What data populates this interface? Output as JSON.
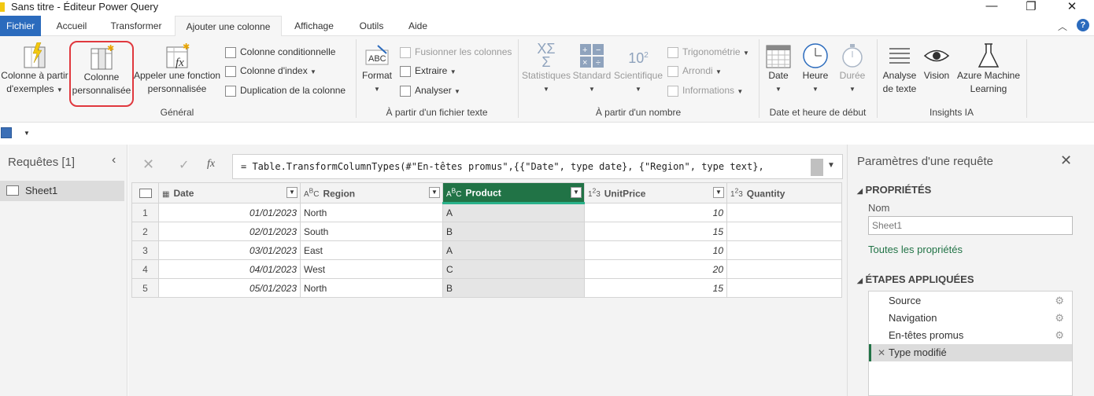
{
  "window": {
    "title": "Sans titre - Éditeur Power Query",
    "minimize": "—",
    "restore": "❐",
    "close": "✕"
  },
  "tabs": [
    "Fichier",
    "Accueil",
    "Transformer",
    "Ajouter une colonne",
    "Affichage",
    "Outils",
    "Aide"
  ],
  "ribbon": {
    "general": {
      "label": "Général",
      "colonne_exemples": [
        "Colonne à partir",
        "d'exemples"
      ],
      "colonne_perso": [
        "Colonne",
        "personnalisée"
      ],
      "appeler_fonction": [
        "Appeler une fonction",
        "personnalisée"
      ],
      "colonne_conditionnelle": "Colonne conditionnelle",
      "colonne_index": "Colonne d'index",
      "duplication": "Duplication de la colonne"
    },
    "texte": {
      "label": "À partir d'un fichier texte",
      "format": "Format",
      "fusionner": "Fusionner les colonnes",
      "extraire": "Extraire",
      "analyser": "Analyser"
    },
    "nombre": {
      "label": "À partir d'un nombre",
      "statistiques": "Statistiques",
      "standard": "Standard",
      "scientifique": "Scientifique",
      "trigonometrie": "Trigonométrie",
      "arrondi": "Arrondi",
      "informations": "Informations"
    },
    "date": {
      "label": "Date et heure de début",
      "date": "Date",
      "heure": "Heure",
      "duree": "Durée"
    },
    "ia": {
      "label": "Insights IA",
      "analyse": [
        "Analyse",
        "de texte"
      ],
      "vision": "Vision",
      "azure": [
        "Azure Machine",
        "Learning"
      ]
    }
  },
  "queries": {
    "title": "Requêtes [1]",
    "items": [
      "Sheet1"
    ]
  },
  "formula": {
    "text": "= Table.TransformColumnTypes(#\"En-têtes promus\",{{\"Date\", type date}, {\"Region\", type text},"
  },
  "table": {
    "columns": [
      {
        "type": "date",
        "name": "Date"
      },
      {
        "type": "ABC",
        "name": "Region"
      },
      {
        "type": "ABC",
        "name": "Product"
      },
      {
        "type": "123",
        "name": "UnitPrice"
      },
      {
        "type": "123",
        "name": "Quantity"
      }
    ],
    "rows": [
      {
        "n": "1",
        "date": "01/01/2023",
        "region": "North",
        "product": "A",
        "price": "10"
      },
      {
        "n": "2",
        "date": "02/01/2023",
        "region": "South",
        "product": "B",
        "price": "15"
      },
      {
        "n": "3",
        "date": "03/01/2023",
        "region": "East",
        "product": "A",
        "price": "10"
      },
      {
        "n": "4",
        "date": "04/01/2023",
        "region": "West",
        "product": "C",
        "price": "20"
      },
      {
        "n": "5",
        "date": "05/01/2023",
        "region": "North",
        "product": "B",
        "price": "15"
      }
    ]
  },
  "settings": {
    "title": "Paramètres d'une requête",
    "properties": "PROPRIÉTÉS",
    "name_label": "Nom",
    "name_value": "Sheet1",
    "all_props": "Toutes les propriétés",
    "steps_title": "ÉTAPES APPLIQUÉES",
    "steps": [
      "Source",
      "Navigation",
      "En-têtes promus",
      "Type modifié"
    ]
  },
  "colors": {
    "accent": "#217346",
    "file_tab": "#2b6bbd",
    "highlight": "#e0383e"
  }
}
